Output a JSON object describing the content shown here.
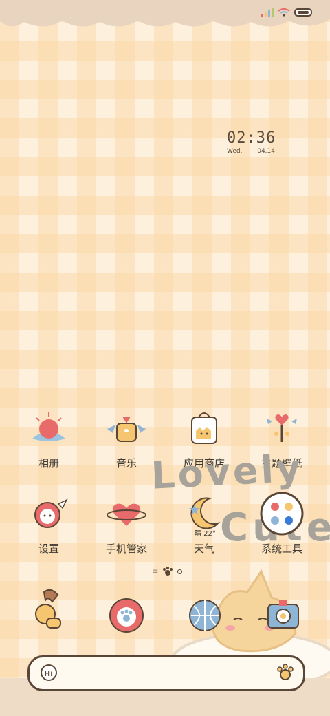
{
  "status": {
    "icons": [
      "signal-icon",
      "wifi-icon",
      "battery-icon"
    ]
  },
  "clock": {
    "time": "02:36",
    "weekday": "Wed.",
    "date": "04.14"
  },
  "apps": {
    "row1": [
      {
        "label": "相册",
        "icon": "sun-icon"
      },
      {
        "label": "音乐",
        "icon": "music-cat-icon"
      },
      {
        "label": "应用商店",
        "icon": "shopping-bag-icon"
      },
      {
        "label": "主题壁纸",
        "icon": "heart-wand-icon"
      }
    ],
    "row2": [
      {
        "label": "设置",
        "icon": "cat-ball-icon"
      },
      {
        "label": "手机管家",
        "icon": "heart-planet-icon"
      },
      {
        "label": "天气",
        "icon": "moon-icon",
        "extra": "晴 22°"
      },
      {
        "label": "系统工具",
        "icon": "folder-icon"
      }
    ]
  },
  "decor": {
    "lovely": "Lovely",
    "cute": "Cute"
  },
  "dock": [
    {
      "icon": "phone-cat-icon"
    },
    {
      "icon": "paw-planet-icon"
    },
    {
      "icon": "ball-icon"
    },
    {
      "icon": "camera-icon"
    }
  ],
  "search": {
    "left_icon": "hi-icon",
    "right_icon": "paw-icon"
  },
  "colors": {
    "accent": "#e86a6a",
    "brown": "#5a4636",
    "gold": "#f6c56f",
    "blue": "#8fb5d6"
  }
}
